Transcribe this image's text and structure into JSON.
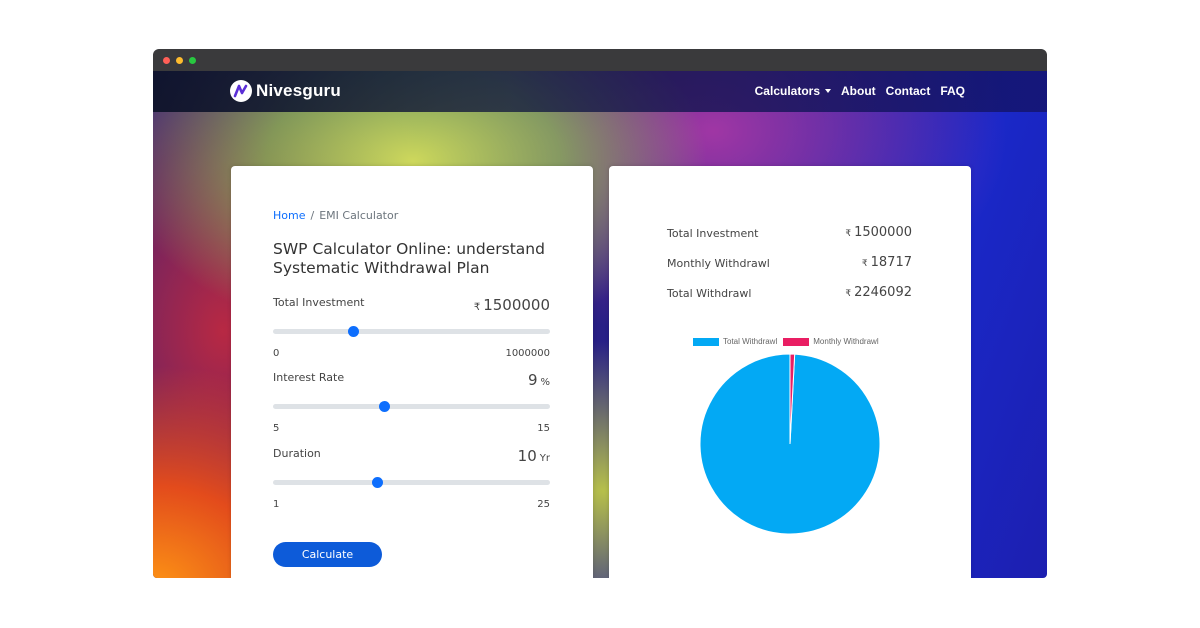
{
  "navbar": {
    "brand": "Nivesguru",
    "items": [
      "Calculators",
      "About",
      "Contact",
      "FAQ"
    ]
  },
  "breadcrumb": {
    "home": "Home",
    "separator": "/",
    "current": "EMI Calculator"
  },
  "page_title": "SWP Calculator Online: understand Systematic Withdrawal Plan",
  "currency_symbol": "₹",
  "fields": {
    "investment": {
      "label": "Total Investment",
      "value": "1500000",
      "unit": "",
      "min": "0",
      "max": "1000000",
      "level": 0.29
    },
    "rate": {
      "label": "Interest Rate",
      "value": "9",
      "unit": "%",
      "min": "5",
      "max": "15",
      "level": 0.4
    },
    "duration": {
      "label": "Duration",
      "value": "10",
      "unit": "Yr",
      "min": "1",
      "max": "25",
      "level": 0.375
    }
  },
  "calculate_label": "Calculate",
  "summary": {
    "total_investment": {
      "label": "Total Investment",
      "value": "1500000"
    },
    "monthly_withdrawl": {
      "label": "Monthly Withdrawl",
      "value": "18717"
    },
    "total_withdrawl": {
      "label": "Total Withdrawl",
      "value": "2246092"
    }
  },
  "colors": {
    "accent": "#0d6efd",
    "button": "#0d5bd9",
    "pie_total": "#03a9f4",
    "pie_monthly": "#e91e63"
  },
  "chart_data": {
    "type": "pie",
    "categories": [
      "Total Withdrawl",
      "Monthly Withdrawl"
    ],
    "values": [
      2246092,
      18717
    ],
    "legend": "top"
  }
}
